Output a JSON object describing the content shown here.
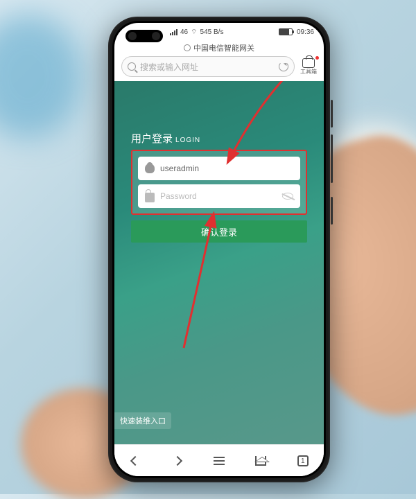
{
  "status_bar": {
    "network_label": "46",
    "speed": "545 B/s",
    "battery_icon": "battery",
    "time": "09:36"
  },
  "browser": {
    "page_title": "中国电信智能网关",
    "search_placeholder": "搜索或输入网址",
    "toolbox_label": "工具箱"
  },
  "login": {
    "title_cn": "用户登录",
    "title_en": "LOGIN",
    "username_value": "useradmin",
    "password_placeholder": "Password",
    "submit_label": "确认登录"
  },
  "quick_link": "快速装维入口",
  "bottom_nav": {
    "tab_count": "1"
  }
}
